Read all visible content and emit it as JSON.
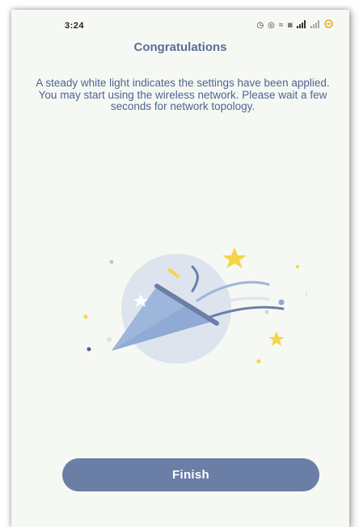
{
  "status_bar": {
    "time": "3:24",
    "icons": [
      "alarm-icon",
      "hotspot-icon",
      "wifi-icon",
      "volte-icon",
      "signal-icon",
      "signal-icon-2",
      "battery-saver-icon"
    ]
  },
  "header": {
    "title": "Congratulations"
  },
  "main": {
    "message": "A steady white light indicates the settings have been applied. You may start using the wireless network. Please wait a few seconds for network topology."
  },
  "footer": {
    "finish_label": "Finish"
  },
  "colors": {
    "accent": "#6a7ea6",
    "title": "#5a6e97",
    "background": "#f6f8f3",
    "star": "#f5d547"
  }
}
